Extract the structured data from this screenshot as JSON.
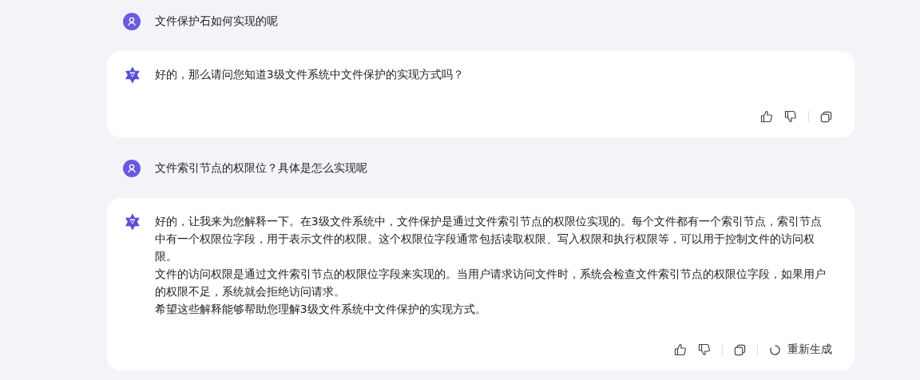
{
  "messages": [
    {
      "kind": "user",
      "text": "文件保护石如何实现的呢"
    },
    {
      "kind": "assistant",
      "paragraphs": [
        "好的，那么请问您知道3级文件系统中文件保护的实现方式吗？"
      ],
      "actions": [
        {
          "kind": "like"
        },
        {
          "kind": "dislike"
        },
        {
          "kind": "separator"
        },
        {
          "kind": "copy"
        }
      ]
    },
    {
      "kind": "user",
      "text": "文件索引节点的权限位？具体是怎么实现呢"
    },
    {
      "kind": "assistant",
      "paragraphs": [
        "好的，让我来为您解释一下。在3级文件系统中，文件保护是通过文件索引节点的权限位实现的。每个文件都有一个索引节点，索引节点中有一个权限位字段，用于表示文件的权限。这个权限位字段通常包括读取权限、写入权限和执行权限等，可以用于控制文件的访问权限。",
        "文件的访问权限是通过文件索引节点的权限位字段来实现的。当用户请求访问文件时，系统会检查文件索引节点的权限位字段，如果用户的权限不足，系统就会拒绝访问请求。",
        "希望这些解释能够帮助您理解3级文件系统中文件保护的实现方式。"
      ],
      "actions": [
        {
          "kind": "like"
        },
        {
          "kind": "dislike"
        },
        {
          "kind": "separator"
        },
        {
          "kind": "copy"
        },
        {
          "kind": "separator"
        },
        {
          "kind": "regenerate",
          "label": "重新生成"
        }
      ]
    }
  ]
}
